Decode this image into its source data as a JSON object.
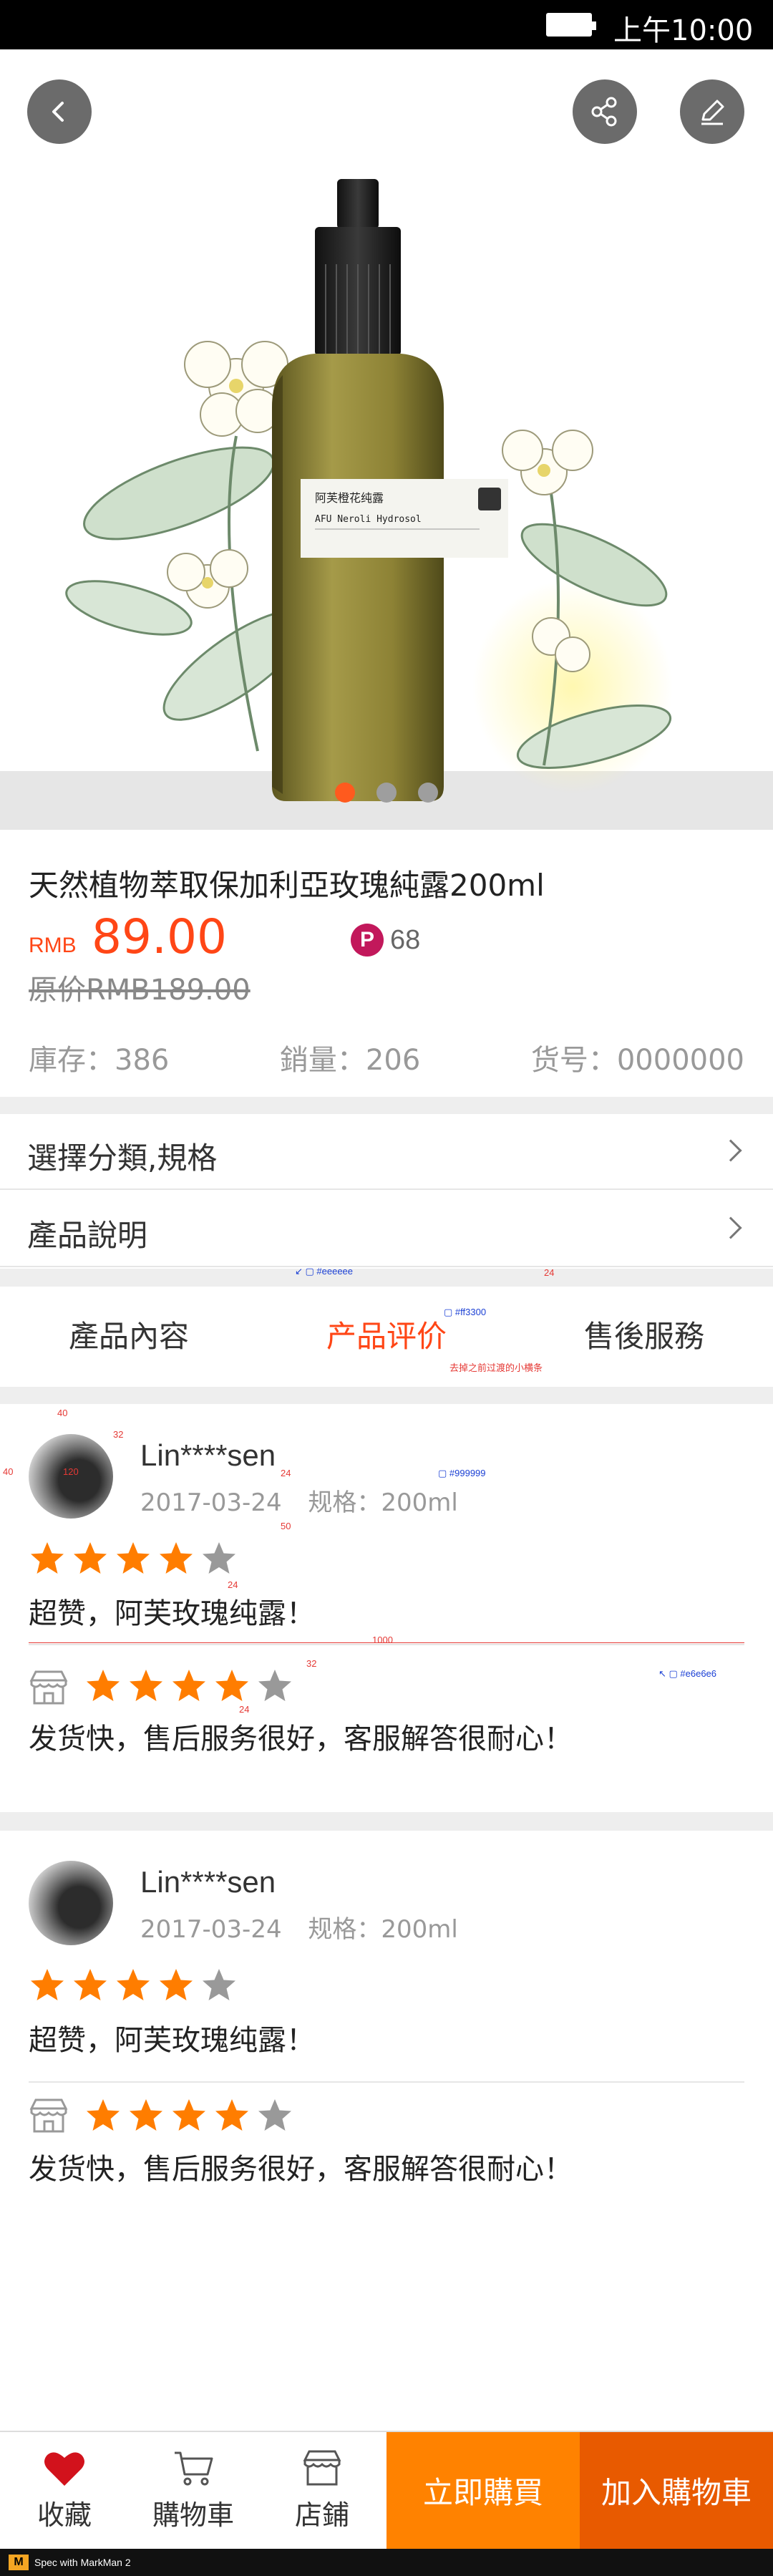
{
  "status_bar": {
    "time": "上午10:00"
  },
  "colors": {
    "accent": "#ff4616",
    "buy_now": "#ff8200",
    "add_cart": "#e85a00",
    "star": "#ff7d00",
    "star_empty": "#999999",
    "divider": "#eeeeee"
  },
  "product": {
    "title": "天然植物萃取保加利亞玫瑰純露200ml",
    "currency": "RMB",
    "price": "89.00",
    "points_badge": "P",
    "points": "68",
    "original_price": "原价RMB189.00",
    "stock": "庫存：386",
    "sales": "銷量：206",
    "sku": "货号：0000000",
    "bottle_label_cn": "阿芙橙花纯露",
    "bottle_label_en": "AFU Neroli Hydrosol"
  },
  "gallery": {
    "count": 3,
    "active": 0
  },
  "menu": [
    {
      "label": "選擇分類,規格"
    },
    {
      "label": "產品說明"
    }
  ],
  "tabs": [
    {
      "label": "產品內容"
    },
    {
      "label": "产品评价"
    },
    {
      "label": "售後服務"
    }
  ],
  "reviews": [
    {
      "name": "Lin****sen",
      "date": "2017-03-24",
      "spec": "规格：200ml",
      "product_rating": 4,
      "product_comment": "超赞，阿芙玫瑰纯露！",
      "shop_rating": 4,
      "shop_comment": "发货快，售后服务很好，客服解答很耐心！"
    },
    {
      "name": "Lin****sen",
      "date": "2017-03-24",
      "spec": "规格：200ml",
      "product_rating": 4,
      "product_comment": "超赞，阿芙玫瑰纯露！",
      "shop_rating": 4,
      "shop_comment": "发货快，售后服务很好，客服解答很耐心！"
    }
  ],
  "annotations": {
    "color_eeeeee": "#eeeeee",
    "color_ff3300": "#ff3300",
    "note_tab": "去掉之前过渡的小横条",
    "color_999999": "#999999",
    "color_e6e6e6": "#e6e6e6",
    "dim_24": "24",
    "dim_40": "40",
    "dim_32": "32",
    "dim_50": "50",
    "dim_1000": "1000",
    "dim_120": "120"
  },
  "bottom_bar": {
    "favorite": "收藏",
    "cart": "購物車",
    "shop": "店鋪",
    "buy_now": "立即購買",
    "add_to_cart": "加入購物車"
  },
  "watermark": {
    "logo": "M",
    "text": "Spec with MarkMan 2"
  }
}
